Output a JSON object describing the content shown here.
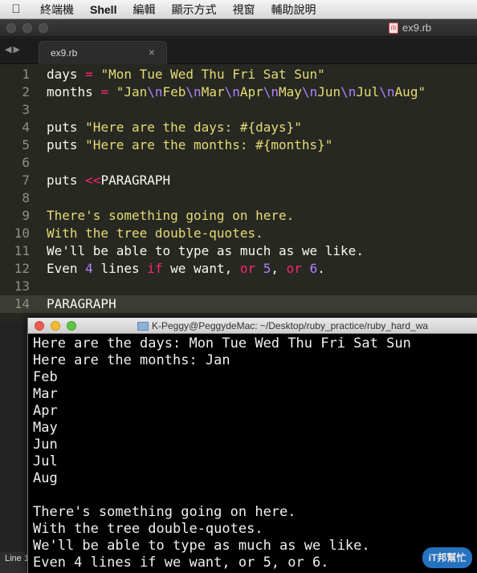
{
  "menubar": {
    "items": [
      "終端機",
      "Shell",
      "編輯",
      "顯示方式",
      "視窗",
      "輔助說明"
    ]
  },
  "editor_window": {
    "filename": "ex9.rb",
    "tab_label": "ex9.rb",
    "lines": [
      {
        "n": "1",
        "segs": [
          [
            "days ",
            ""
          ],
          [
            "=",
            "kw"
          ],
          [
            " \"Mon Tue Wed Thu Fri Sat Sun\"",
            "str"
          ]
        ]
      },
      {
        "n": "2",
        "segs": [
          [
            "months ",
            ""
          ],
          [
            "=",
            "kw"
          ],
          [
            " \"Jan",
            "str"
          ],
          [
            "\\n",
            "esc"
          ],
          [
            "Feb",
            "str"
          ],
          [
            "\\n",
            "esc"
          ],
          [
            "Mar",
            "str"
          ],
          [
            "\\n",
            "esc"
          ],
          [
            "Apr",
            "str"
          ],
          [
            "\\n",
            "esc"
          ],
          [
            "May",
            "str"
          ],
          [
            "\\n",
            "esc"
          ],
          [
            "Jun",
            "str"
          ],
          [
            "\\n",
            "esc"
          ],
          [
            "Jul",
            "str"
          ],
          [
            "\\n",
            "esc"
          ],
          [
            "Aug\"",
            "str"
          ]
        ]
      },
      {
        "n": "3",
        "segs": []
      },
      {
        "n": "4",
        "segs": [
          [
            "puts ",
            ""
          ],
          [
            "\"Here are the days: #{days}\"",
            "str"
          ]
        ]
      },
      {
        "n": "5",
        "segs": [
          [
            "puts ",
            ""
          ],
          [
            "\"Here are the months: #{months}\"",
            "str"
          ]
        ]
      },
      {
        "n": "6",
        "segs": []
      },
      {
        "n": "7",
        "segs": [
          [
            "puts ",
            ""
          ],
          [
            "<<",
            "kw"
          ],
          [
            "PARAGRAPH",
            ""
          ]
        ]
      },
      {
        "n": "8",
        "segs": []
      },
      {
        "n": "9",
        "segs": [
          [
            "There",
            "str"
          ],
          [
            "'s something going on here.",
            "str"
          ]
        ]
      },
      {
        "n": "10",
        "segs": [
          [
            "With the tree double-quotes.",
            "str"
          ]
        ]
      },
      {
        "n": "11",
        "segs": [
          [
            "We",
            ""
          ],
          [
            "'ll be able to type as much as we like.",
            ""
          ]
        ]
      },
      {
        "n": "12",
        "segs": [
          [
            "Even ",
            ""
          ],
          [
            "4",
            "num"
          ],
          [
            " lines ",
            ""
          ],
          [
            "if",
            "kw"
          ],
          [
            " we want, ",
            ""
          ],
          [
            "or",
            "kw"
          ],
          [
            " ",
            ""
          ],
          [
            "5",
            "num"
          ],
          [
            ", ",
            ""
          ],
          [
            "or",
            "kw"
          ],
          [
            " ",
            ""
          ],
          [
            "6",
            "num"
          ],
          [
            ".",
            ""
          ]
        ]
      },
      {
        "n": "13",
        "segs": []
      },
      {
        "n": "14",
        "segs": [
          [
            "PARAGRAPH",
            ""
          ]
        ],
        "current": true
      }
    ],
    "status_text": "Line 1"
  },
  "terminal": {
    "title": "K-Peggy@PeggydeMac: ~/Desktop/ruby_practice/ruby_hard_wa",
    "lines": [
      "Here are the days: Mon Tue Wed Thu Fri Sat Sun",
      "Here are the months: Jan",
      "Feb",
      "Mar",
      "Apr",
      "May",
      "Jun",
      "Jul",
      "Aug",
      "",
      "There's something going on here.",
      "With the tree double-quotes.",
      "We'll be able to type as much as we like.",
      "Even 4 lines if we want, or 5, or 6."
    ]
  },
  "watermark_text": "iT邦幫忙",
  "colors": {
    "editor_bg": "#272822",
    "keyword": "#f92672",
    "string": "#e6db74",
    "number": "#ae81ff",
    "terminal_bg": "#000000"
  }
}
